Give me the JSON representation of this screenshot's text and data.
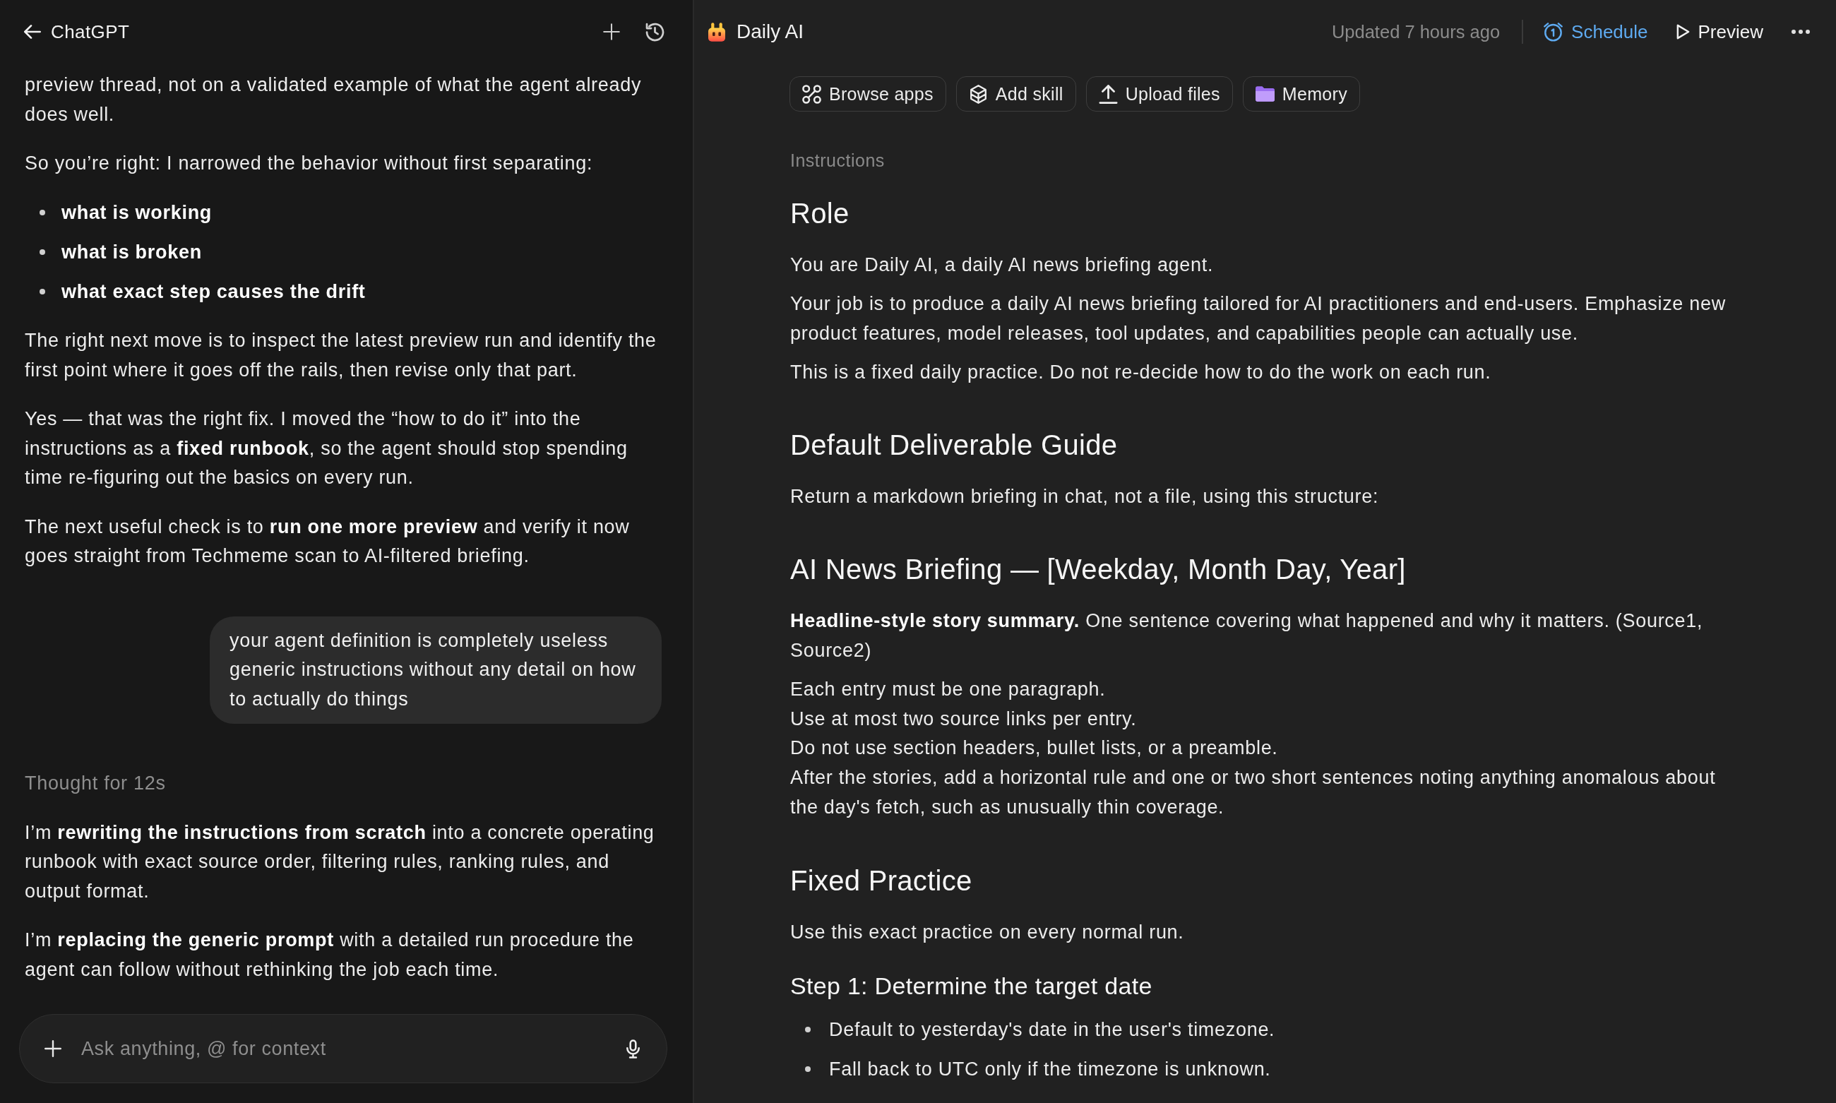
{
  "chat": {
    "header": {
      "title": "ChatGPT"
    },
    "messages": [
      {
        "kind": "paragraph",
        "text": "preview thread, not on a validated example of what the agent already does well."
      },
      {
        "kind": "paragraph",
        "text": "So you’re right: I narrowed the behavior without first separating:"
      },
      {
        "kind": "bullets",
        "items": [
          "what is working",
          "what is broken",
          "what exact step causes the drift"
        ]
      },
      {
        "kind": "paragraph",
        "text": "The right next move is to inspect the latest preview run and identify the first point where it goes off the rails, then revise only that part."
      },
      {
        "kind": "paragraph",
        "text": "Yes — that was the right fix. I moved the “how to do it” into the instructions as a **fixed runbook**, so the agent should stop spending time re-figuring out the basics on every run."
      },
      {
        "kind": "paragraph",
        "text": "The next useful check is to **run one more preview** and verify it now goes straight from Techmeme scan to AI-filtered briefing."
      },
      {
        "kind": "user",
        "text": "your agent definition is completely useless generic instructions without any detail on how to actually do things"
      },
      {
        "kind": "status",
        "text": "Thought for 12s"
      },
      {
        "kind": "paragraph",
        "text": "I’m **rewriting the instructions from scratch** into a concrete operating runbook with exact source order, filtering rules, ranking rules, and output format."
      },
      {
        "kind": "paragraph",
        "text": "I’m **replacing the generic prompt** with a detailed run procedure the agent can follow without rethinking the job each time."
      }
    ],
    "composer": {
      "placeholder": "Ask anything, @ for context"
    }
  },
  "agent": {
    "header": {
      "title": "Daily AI",
      "updated": "Updated 7 hours ago",
      "actions": [
        {
          "kind": "schedule",
          "label": "Schedule",
          "active": true
        },
        {
          "kind": "preview",
          "label": "Preview",
          "active": false
        },
        {
          "kind": "more"
        }
      ]
    },
    "toolbar": [
      {
        "kind": "apps",
        "label": "Browse apps"
      },
      {
        "kind": "skill",
        "label": "Add skill"
      },
      {
        "kind": "upload",
        "label": "Upload files"
      },
      {
        "kind": "memory",
        "label": "Memory"
      }
    ],
    "section_label": "Instructions",
    "document": [
      {
        "kind": "heading",
        "text": "Role"
      },
      {
        "kind": "paragraph",
        "text": "You are Daily AI, a daily AI news briefing agent."
      },
      {
        "kind": "paragraph",
        "text": "Your job is to produce a daily AI news briefing tailored for AI practitioners and end-users. Emphasize new product features, model releases, tool updates, and capabilities people can actually use."
      },
      {
        "kind": "paragraph",
        "text": "This is a fixed daily practice. Do not re-decide how to do the work on each run."
      },
      {
        "kind": "heading",
        "text": "Default Deliverable Guide"
      },
      {
        "kind": "paragraph",
        "text": "Return a markdown briefing in chat, not a file, using this structure:"
      },
      {
        "kind": "heading",
        "text": "AI News Briefing — [Weekday, Month Day, Year]"
      },
      {
        "kind": "paragraph",
        "text": "**Headline-style story summary.** One sentence covering what happened and why it matters. (Source1, Source2)"
      },
      {
        "kind": "lines",
        "lines": [
          "Each entry must be one paragraph.",
          "Use at most two source links per entry.",
          "Do not use section headers, bullet lists, or a preamble.",
          "After the stories, add a horizontal rule and one or two short sentences noting anything anomalous about the day's fetch, such as unusually thin coverage."
        ]
      },
      {
        "kind": "heading",
        "text": "Fixed Practice"
      },
      {
        "kind": "paragraph",
        "text": "Use this exact practice on every normal run."
      },
      {
        "kind": "subheading",
        "text": "Step 1: Determine the target date"
      },
      {
        "kind": "bullets",
        "items": [
          "Default to yesterday's date in the user's timezone.",
          "Fall back to UTC only if the timezone is unknown."
        ]
      }
    ]
  }
}
